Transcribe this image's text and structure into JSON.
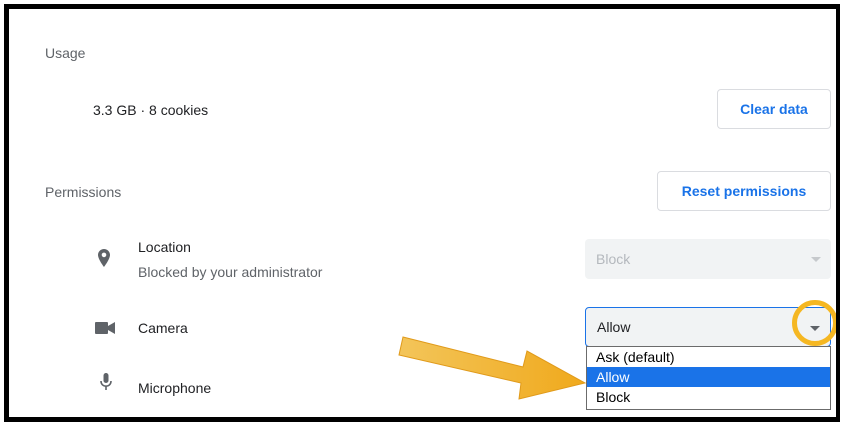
{
  "usage": {
    "section_title": "Usage",
    "summary": "3.3 GB · 8 cookies",
    "clear_data_label": "Clear data"
  },
  "permissions": {
    "section_title": "Permissions",
    "reset_label": "Reset permissions",
    "items": [
      {
        "name": "Location",
        "subtitle": "Blocked by your administrator",
        "icon": "location-pin-icon",
        "value": "Block",
        "disabled": true
      },
      {
        "name": "Camera",
        "icon": "video-camera-icon",
        "value": "Allow",
        "disabled": false
      },
      {
        "name": "Microphone",
        "icon": "microphone-icon"
      }
    ]
  },
  "dropdown": {
    "options": [
      "Ask (default)",
      "Allow",
      "Block"
    ],
    "selected": "Allow"
  },
  "colors": {
    "accent": "#1a73e8",
    "highlight": "#f5b722"
  }
}
